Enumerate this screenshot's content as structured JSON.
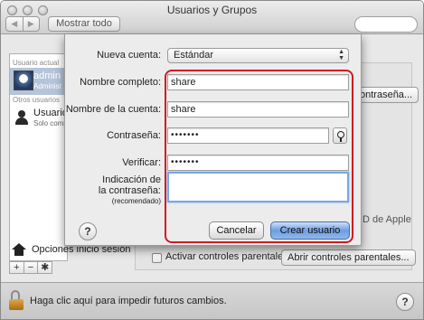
{
  "window": {
    "title": "Usuarios y Grupos",
    "toolbar": {
      "back": "◀",
      "forward": "▶",
      "show_all": "Mostrar todo"
    }
  },
  "sidebar": {
    "section_current": "Usuario actual",
    "current_user": {
      "name": "admin",
      "role": "Administ"
    },
    "section_others": "Otros usuarios",
    "other_user": {
      "name": "Usuario",
      "role": "Solo compa"
    },
    "login_options": "Opciones inicio sesión",
    "buttons": {
      "add": "+",
      "remove": "−",
      "gear": "✱"
    }
  },
  "background_pane": {
    "password_button_partial": "ontraseña...",
    "apple_id_partial": "D de Apple",
    "parental_controls_checkbox": "Activar controles parentales",
    "open_parental_controls": "Abrir controles parentales..."
  },
  "footer": {
    "lock_text": "Haga clic aquí para impedir futuros cambios.",
    "help": "?"
  },
  "sheet": {
    "new_account_label": "Nueva cuenta:",
    "new_account_value": "Estándar",
    "full_name_label": "Nombre completo:",
    "full_name_value": "share",
    "account_name_label": "Nombre de la cuenta:",
    "account_name_value": "share",
    "password_label": "Contraseña:",
    "password_value": "•••••••",
    "verify_label": "Verificar:",
    "verify_value": "•••••••",
    "hint_label_line1": "Indicación de",
    "hint_label_line2": "la contraseña:",
    "hint_label_line3": "(recomendado)",
    "hint_value": "",
    "help": "?",
    "cancel": "Cancelar",
    "create": "Crear usuario"
  },
  "colors": {
    "highlight": "#d21a22",
    "default_button": "#6e9ee0",
    "selection": "#b5c4d9"
  }
}
